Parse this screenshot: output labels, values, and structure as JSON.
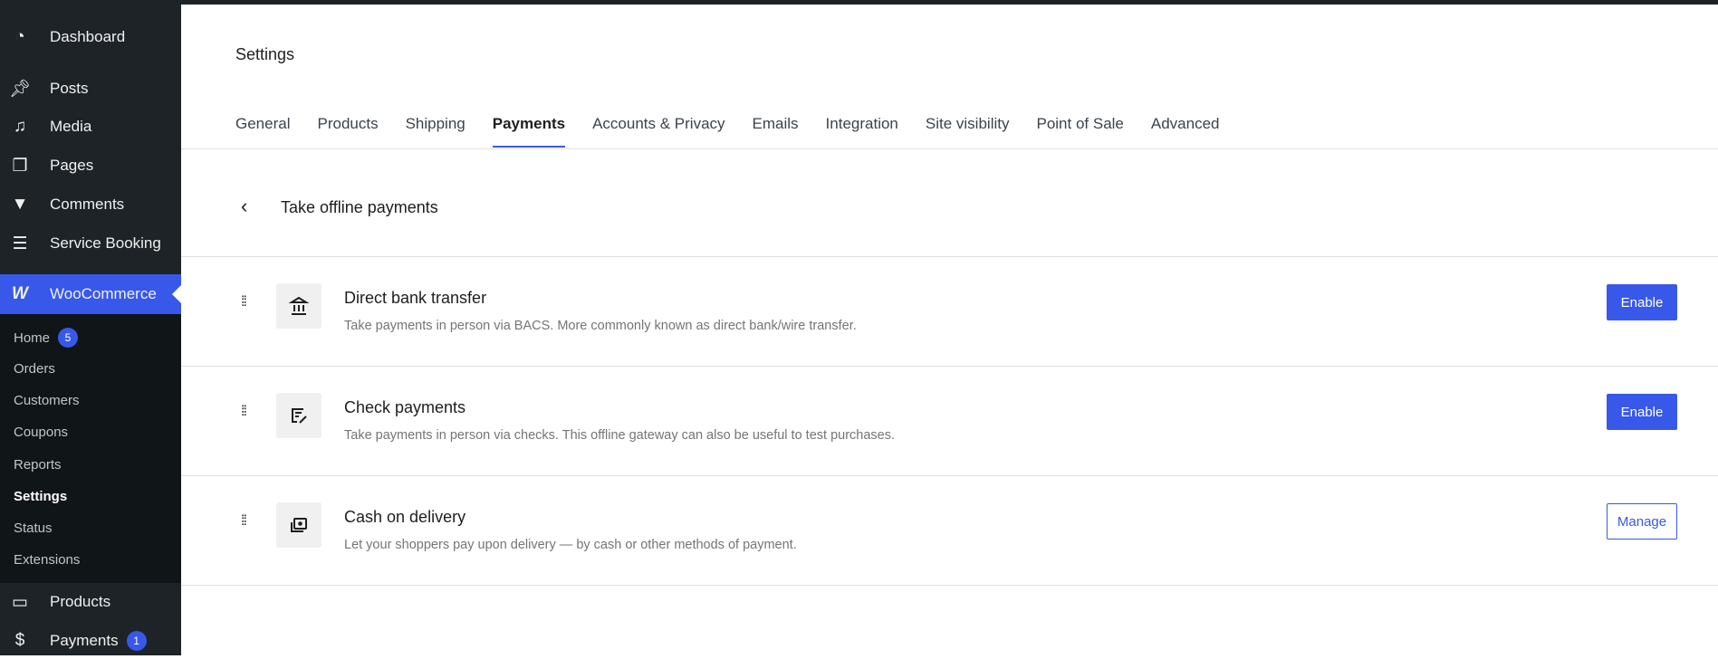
{
  "sidebar": {
    "items": [
      {
        "label": "Dashboard",
        "icon": "dashboard-icon"
      },
      {
        "label": "Posts",
        "icon": "pin-icon"
      },
      {
        "label": "Media",
        "icon": "media-icon"
      },
      {
        "label": "Pages",
        "icon": "pages-icon"
      },
      {
        "label": "Comments",
        "icon": "comment-icon"
      },
      {
        "label": "Service Booking",
        "icon": "list-icon"
      },
      {
        "label": "WooCommerce",
        "icon": "woo-icon"
      },
      {
        "label": "Products",
        "icon": "archive-icon"
      },
      {
        "label": "Payments",
        "icon": "dollar-icon",
        "badge": "1"
      }
    ],
    "submenu": [
      {
        "label": "Home",
        "badge": "5"
      },
      {
        "label": "Orders"
      },
      {
        "label": "Customers"
      },
      {
        "label": "Coupons"
      },
      {
        "label": "Reports"
      },
      {
        "label": "Settings"
      },
      {
        "label": "Status"
      },
      {
        "label": "Extensions"
      }
    ]
  },
  "header": {
    "title": "Settings"
  },
  "tabs": [
    "General",
    "Products",
    "Shipping",
    "Payments",
    "Accounts & Privacy",
    "Emails",
    "Integration",
    "Site visibility",
    "Point of Sale",
    "Advanced"
  ],
  "active_tab": "Payments",
  "section": {
    "title": "Take offline payments"
  },
  "methods": [
    {
      "title": "Direct bank transfer",
      "desc": "Take payments in person via BACS. More commonly known as direct bank/wire transfer.",
      "button": "Enable",
      "icon": "bank-icon"
    },
    {
      "title": "Check payments",
      "desc": "Take payments in person via checks. This offline gateway can also be useful to test purchases.",
      "button": "Enable",
      "icon": "check-icon"
    },
    {
      "title": "Cash on delivery",
      "desc": "Let your shoppers pay upon delivery — by cash or other methods of payment.",
      "button": "Manage",
      "icon": "cash-icon"
    }
  ],
  "colors": {
    "accent": "#3858e9",
    "sidebar": "#1d2327"
  }
}
